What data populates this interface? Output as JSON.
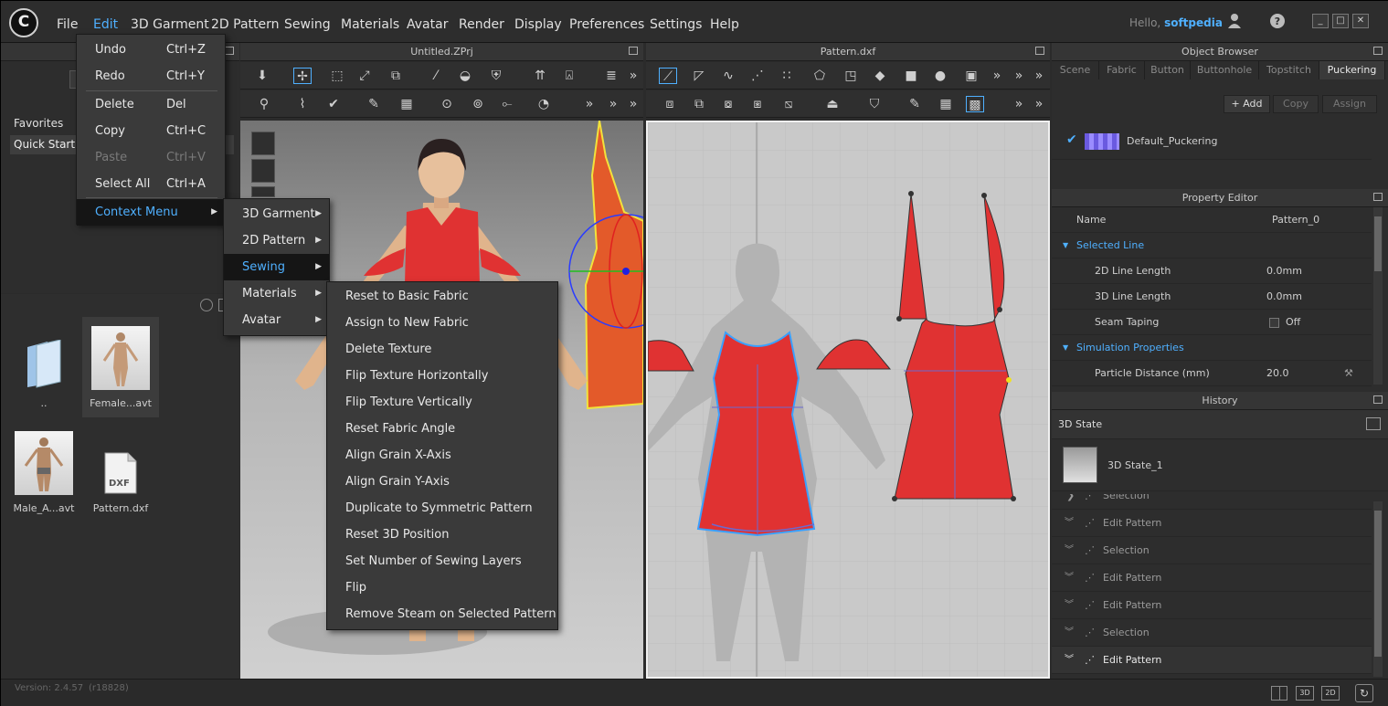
{
  "menubar": {
    "items": [
      "File",
      "Edit",
      "3D Garment",
      "2D Pattern",
      "Sewing",
      "Materials",
      "Avatar",
      "Render",
      "Display",
      "Preferences",
      "Settings",
      "Help"
    ],
    "hello_prefix": "Hello,",
    "user": "softpedia"
  },
  "left": {
    "favorites": "Favorites",
    "quick_start": "Quick Start",
    "files": [
      {
        "name": ".."
      },
      {
        "name": "Female...avt"
      },
      {
        "name": "Male_A...avt"
      },
      {
        "name": "Pattern.dxf"
      }
    ],
    "dxf_label": "DXF"
  },
  "status": {
    "version": "Version: 2.4.57",
    "build": "(r18828)"
  },
  "viewports": {
    "v3d_title": "Untitled.ZPrj",
    "v2d_title": "Pattern.dxf",
    "more": "»"
  },
  "edit_menu": {
    "items": [
      {
        "label": "Undo",
        "shortcut": "Ctrl+Z"
      },
      {
        "label": "Redo",
        "shortcut": "Ctrl+Y"
      },
      {
        "label": "Delete",
        "shortcut": "Del"
      },
      {
        "label": "Copy",
        "shortcut": "Ctrl+C"
      },
      {
        "label": "Paste",
        "shortcut": "Ctrl+V"
      },
      {
        "label": "Select All",
        "shortcut": "Ctrl+A"
      },
      {
        "label": "Context Menu",
        "shortcut": ""
      }
    ]
  },
  "context_menu": {
    "items": [
      "3D Garment",
      "2D Pattern",
      "Sewing",
      "Materials",
      "Avatar"
    ]
  },
  "sewing_menu": {
    "items": [
      "Reset to Basic Fabric",
      "Assign to New Fabric",
      "Delete Texture",
      "Flip Texture Horizontally",
      "Flip Texture Vertically",
      "Reset Fabric Angle",
      "Align Grain X-Axis",
      "Align Grain Y-Axis",
      "Duplicate to Symmetric Pattern",
      "Reset 3D Position",
      "Set Number of Sewing Layers",
      "Flip",
      "Remove Steam on Selected Pattern"
    ]
  },
  "object_browser": {
    "title": "Object Browser",
    "tabs": [
      "Scene",
      "Fabric",
      "Button",
      "Buttonhole",
      "Topstitch",
      "Puckering"
    ],
    "add": "Add",
    "copy": "Copy",
    "assign": "Assign",
    "item": "Default_Puckering"
  },
  "property_editor": {
    "title": "Property Editor",
    "name_label": "Name",
    "name_value": "Pattern_0",
    "selected_line": "Selected Line",
    "line_2d_label": "2D Line Length",
    "line_2d_value": "0.0mm",
    "line_3d_label": "3D Line Length",
    "line_3d_value": "0.0mm",
    "seam_taping_label": "Seam Taping",
    "seam_taping_value": "Off",
    "sim_props": "Simulation Properties",
    "particle_label": "Particle Distance (mm)",
    "particle_value": "20.0"
  },
  "history": {
    "title": "History",
    "state_label": "3D State",
    "state_item": "3D State_1",
    "partial": "Selection",
    "rows": [
      "Edit Pattern",
      "Selection",
      "Edit Pattern",
      "Edit Pattern",
      "Selection",
      "Edit Pattern"
    ]
  },
  "bottom_bar": {
    "b3d": "3D",
    "b2d": "2D"
  },
  "colors": {
    "accent": "#4fb0ff",
    "garment": "#e03232",
    "garment_3d": "#e35a2a"
  }
}
